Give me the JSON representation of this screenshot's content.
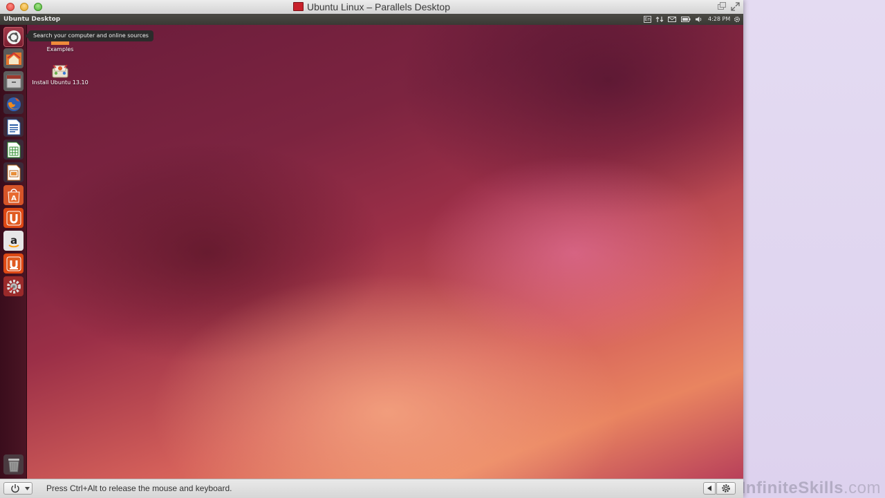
{
  "window": {
    "title": "Ubuntu Linux – Parallels Desktop"
  },
  "ubuntu_panel": {
    "title": "Ubuntu Desktop",
    "keyboard_indicator": "En",
    "clock": "4:28 PM"
  },
  "launcher": {
    "items": [
      {
        "name": "dash-home",
        "icon": "ubuntu-logo-icon"
      },
      {
        "name": "files-home",
        "icon": "home-folder-icon"
      },
      {
        "name": "file-manager",
        "icon": "drawer-icon"
      },
      {
        "name": "firefox",
        "icon": "firefox-icon"
      },
      {
        "name": "libreoffice-writer",
        "icon": "writer-icon"
      },
      {
        "name": "libreoffice-calc",
        "icon": "calc-icon"
      },
      {
        "name": "libreoffice-impress",
        "icon": "impress-icon"
      },
      {
        "name": "software-center",
        "icon": "software-center-icon"
      },
      {
        "name": "ubuntu-one",
        "icon": "ubuntu-one-icon"
      },
      {
        "name": "amazon",
        "icon": "amazon-icon"
      },
      {
        "name": "ubuntu-one-music",
        "icon": "ubuntu-one-music-icon"
      },
      {
        "name": "system-settings",
        "icon": "settings-icon"
      },
      {
        "name": "trash",
        "icon": "trash-icon"
      }
    ],
    "tooltip": "Search your computer and online sources"
  },
  "desktop": {
    "icons": [
      {
        "label": "Examples",
        "icon": "folder-icon"
      },
      {
        "label": "Install Ubuntu 13.10",
        "icon": "installer-icon"
      }
    ]
  },
  "statusbar": {
    "message": "Press Ctrl+Alt to release the mouse and keyboard."
  },
  "watermark": {
    "brand": "InfiniteSkills",
    "suffix": ".com"
  }
}
